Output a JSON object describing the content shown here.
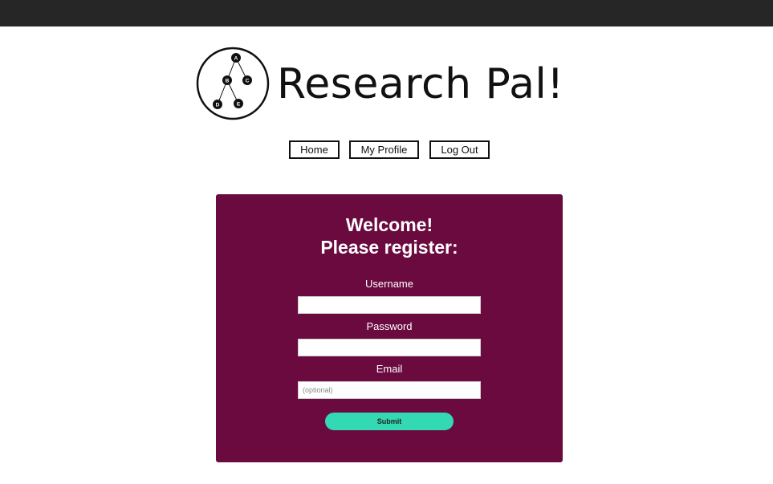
{
  "brand": {
    "name": "Research Pal!",
    "tree_nodes": [
      "A",
      "B",
      "C",
      "D",
      "E"
    ]
  },
  "nav": {
    "items": [
      {
        "label": "Home"
      },
      {
        "label": "My Profile"
      },
      {
        "label": "Log Out"
      }
    ]
  },
  "form": {
    "title_line1": "Welcome!",
    "title_line2": "Please register:",
    "username_label": "Username",
    "username_value": "",
    "password_label": "Password",
    "password_value": "",
    "email_label": "Email",
    "email_placeholder": "(optional)",
    "email_value": "",
    "submit_label": "Submit"
  },
  "colors": {
    "topbar": "#262626",
    "card": "#6b0a3f",
    "submit": "#33d9b2"
  }
}
